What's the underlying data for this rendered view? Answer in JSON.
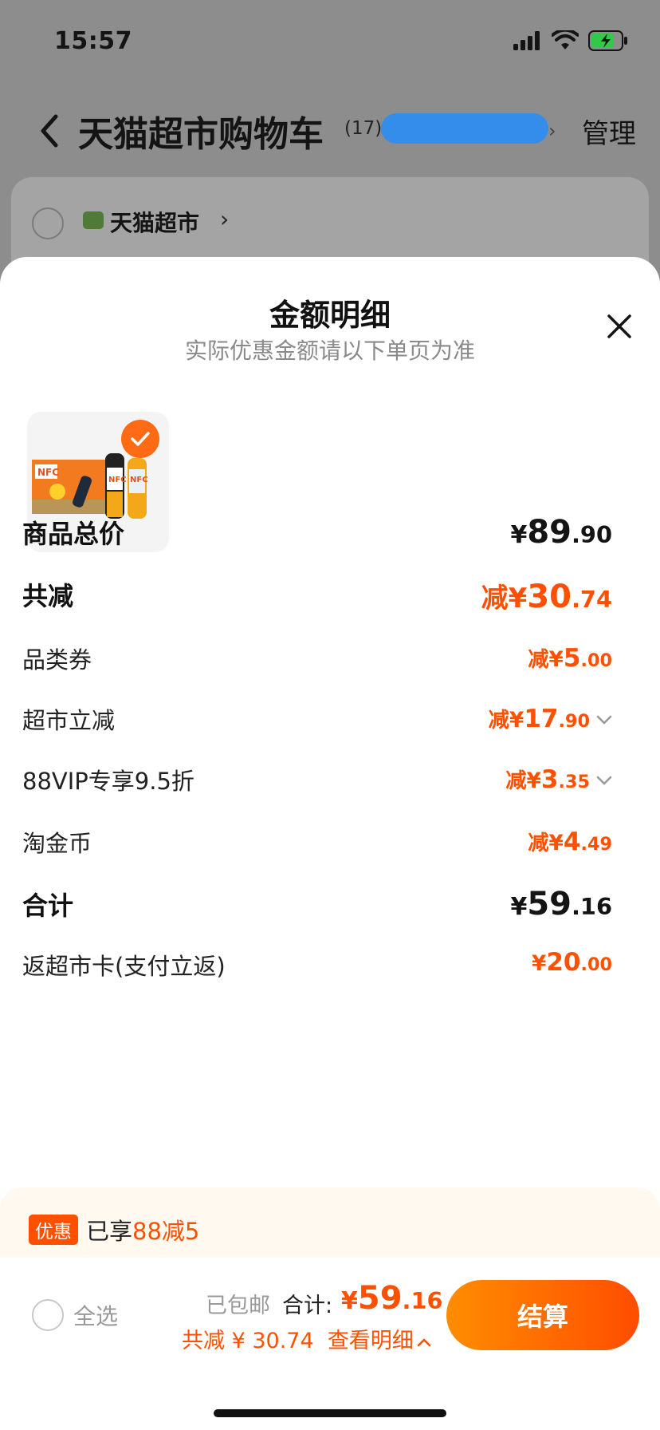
{
  "status_bar": {
    "time": "15:57"
  },
  "nav": {
    "title": "天猫超市购物车",
    "count": "(17)",
    "manage": "管理"
  },
  "store": {
    "name": "天猫超市",
    "chevron": "›"
  },
  "sheet": {
    "title": "金额明细",
    "subtitle": "实际优惠金额请以下单页为准",
    "product_alt_icon": "product-thumbnail-nfc-juice"
  },
  "breakdown": {
    "subtotal": {
      "label": "商品总价",
      "currency": "¥",
      "int": "89",
      "dec": ".90"
    },
    "total_discount": {
      "label": "共减",
      "prefix": "减¥",
      "int": "30",
      "dec": ".74"
    },
    "category_coupon": {
      "label": "品类券",
      "prefix": "减¥",
      "int": "5",
      "dec": ".00"
    },
    "market_discount": {
      "label": "超市立减",
      "prefix": "减¥",
      "int": "17",
      "dec": ".90"
    },
    "vip_discount": {
      "label": "88VIP专享9.5折",
      "prefix": "减¥",
      "int": "3",
      "dec": ".35"
    },
    "taojinbi": {
      "label": "淘金币",
      "prefix": "减¥",
      "int": "4",
      "dec": ".49"
    },
    "total": {
      "label": "合计",
      "currency": "¥",
      "int": "59",
      "dec": ".16"
    },
    "cashback": {
      "label": "返超市卡(支付立返)",
      "currency": "¥",
      "int": "20",
      "dec": ".00"
    }
  },
  "promo": {
    "tag": "优惠",
    "text_prefix": "已享",
    "text_highlight": "88减5"
  },
  "bottom": {
    "select_all": "全选",
    "free_shipping": "已包邮",
    "total_label": "合计:",
    "total_currency": "¥",
    "total_int": "59",
    "total_dec": ".16",
    "discount_line": "共减 ¥ 30.74",
    "view_detail": "查看明细",
    "view_detail_icon": "chevron-up-icon",
    "checkout": "结算"
  },
  "colors": {
    "accent": "#ff5000",
    "sheet_bg": "#ffffff",
    "overlay_bg": "#8d8d8d"
  }
}
